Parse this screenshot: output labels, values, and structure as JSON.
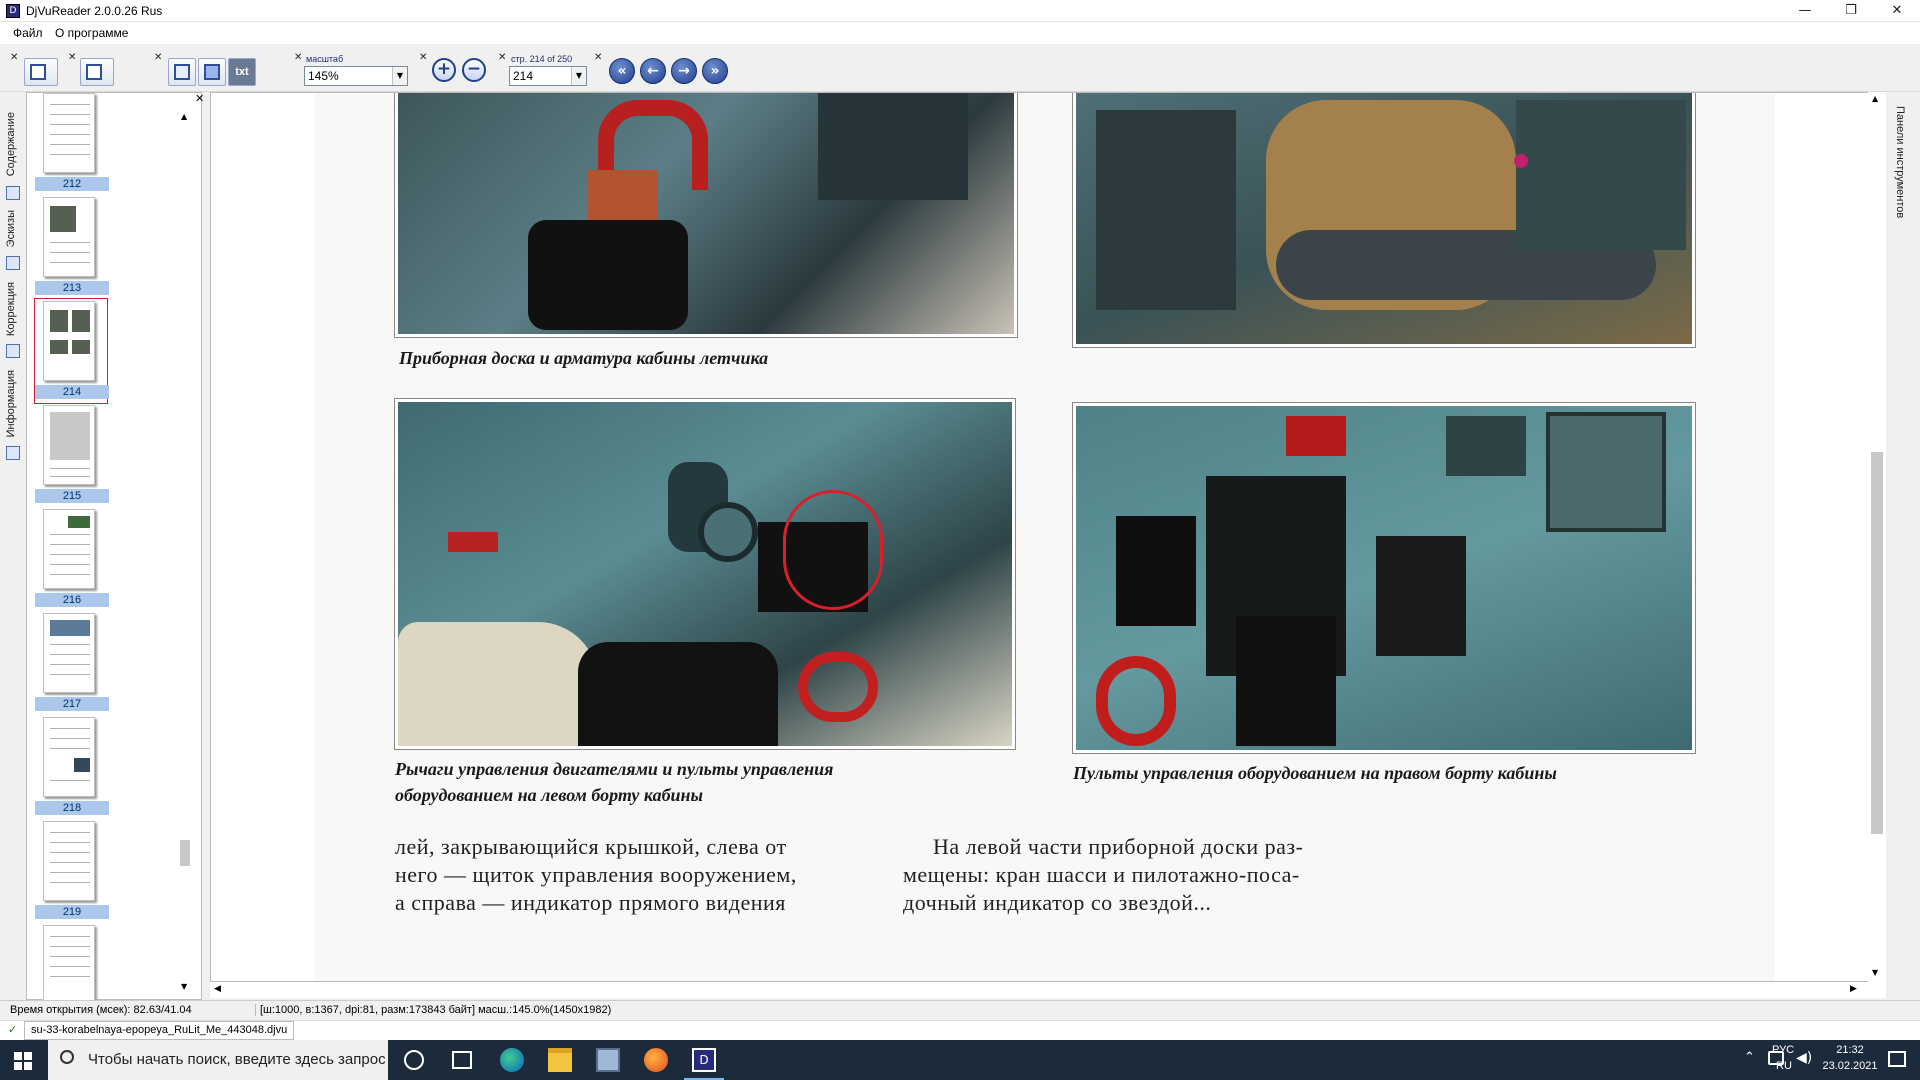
{
  "window": {
    "title": "DjVuReader 2.0.0.26 Rus"
  },
  "menu": {
    "file": "Файл",
    "about": "О программе"
  },
  "toolbar": {
    "zoom_label": "масштаб",
    "zoom_value": "145%",
    "page_label": "стр. 214 of 250",
    "page_value": "214",
    "txt_button": "txt",
    "zoom_in": "+",
    "zoom_out": "−",
    "nav_first": "«",
    "nav_prev": "←",
    "nav_next": "→",
    "nav_last": "»"
  },
  "left_tabs": {
    "contents": "Содержание",
    "thumbnails": "Эскизы",
    "correction": "Коррекция",
    "information": "Информация"
  },
  "thumbnails": [
    {
      "page": "212"
    },
    {
      "page": "213"
    },
    {
      "page": "214",
      "selected": true
    },
    {
      "page": "215"
    },
    {
      "page": "216"
    },
    {
      "page": "217"
    },
    {
      "page": "218"
    },
    {
      "page": "219"
    },
    {
      "page": ""
    }
  ],
  "right_panel": {
    "tools": "Панели инструментов"
  },
  "document": {
    "caption_top": "Приборная доска и арматура кабины летчика",
    "caption_left_1": "Рычаги управления двигателями и пульты управления",
    "caption_left_2": "оборудованием на левом борту кабины",
    "caption_right": "Пульты управления оборудованием на правом борту кабины",
    "left_text_1": "лей, закрывающийся крышкой, слева от",
    "left_text_2": "него — щиток управления вооружением,",
    "left_text_3": "а справа — индикатор прямого видения",
    "right_text_1": "На левой части приборной доски раз-",
    "right_text_2": "мещены: кран шасси и пилотажно-поса-",
    "right_text_3": "дочный индикатор со звездой...",
    "colors": {
      "annotation": "#d8202a",
      "panel": "#5a8d92"
    }
  },
  "status": {
    "open_time": "Время открытия (мсек): 82.63/41.04",
    "info": "[ш:1000, в:1367, dpi:81, разм:173843 байт] масш.:145.0%(1450x1982)"
  },
  "file_tab": {
    "name": "su-33-korabelnaya-epopeya_RuLit_Me_443048.djvu"
  },
  "taskbar": {
    "search_placeholder": "Чтобы начать поиск, введите здесь запрос",
    "lang_top": "РУС",
    "lang_bottom": "RU",
    "time": "21:32",
    "date": "23.02.2021"
  }
}
